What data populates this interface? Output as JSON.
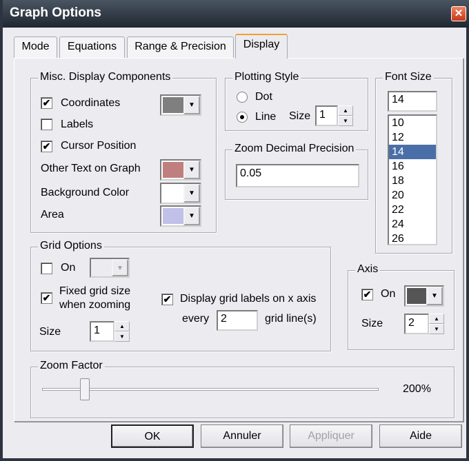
{
  "window": {
    "title": "Graph Options",
    "close": "✕"
  },
  "tabs": [
    {
      "label": "Mode"
    },
    {
      "label": "Equations"
    },
    {
      "label": "Range & Precision"
    },
    {
      "label": "Display"
    }
  ],
  "misc": {
    "title": "Misc. Display Components",
    "coordinates": {
      "label": "Coordinates",
      "checked": true,
      "color": "#7f7f7f"
    },
    "labels": {
      "label": "Labels",
      "checked": false
    },
    "cursor": {
      "label": "Cursor Position",
      "checked": true
    },
    "other_text": {
      "label": "Other Text on Graph",
      "color": "#c07f7f"
    },
    "background": {
      "label": "Background Color",
      "color": "#ffffff"
    },
    "area": {
      "label": "Area",
      "color": "#c0c0e8"
    }
  },
  "plotting": {
    "title": "Plotting Style",
    "dot": "Dot",
    "line": "Line",
    "selected": "Line",
    "size_label": "Size",
    "size": "1"
  },
  "zoom_precision": {
    "title": "Zoom Decimal Precision",
    "value": "0.05"
  },
  "font_size": {
    "title": "Font Size",
    "value": "14",
    "options": [
      "10",
      "12",
      "14",
      "16",
      "18",
      "20",
      "22",
      "24",
      "26"
    ],
    "selected": "14"
  },
  "grid": {
    "title": "Grid Options",
    "on_label": "On",
    "fixed_1": "Fixed grid size",
    "fixed_2": "when zooming",
    "size_label": "Size",
    "size": "1",
    "display_labels": "Display grid labels on x axis",
    "every": "every",
    "every_value": "2",
    "grid_lines": "grid line(s)"
  },
  "axis": {
    "title": "Axis",
    "on_label": "On",
    "color": "#555555",
    "size_label": "Size",
    "size": "2"
  },
  "zoom_factor": {
    "title": "Zoom Factor",
    "value": "200%",
    "slider_fraction": 0.12
  },
  "buttons": {
    "ok": "OK",
    "cancel": "Annuler",
    "apply": "Appliquer",
    "help": "Aide"
  },
  "glyphs": {
    "check": "✔",
    "down": "▼",
    "up": "▲"
  }
}
